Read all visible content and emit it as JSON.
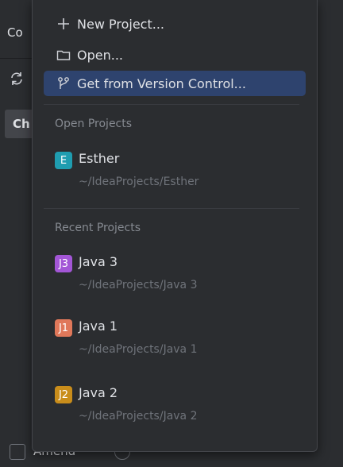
{
  "background": {
    "row1_text": "Co",
    "ch_text": "Ch",
    "amend_label": "Amend"
  },
  "menu": {
    "new_project": "New Project...",
    "open": "Open...",
    "get_from_vcs": "Get from Version Control..."
  },
  "open_projects": {
    "header": "Open Projects",
    "items": [
      {
        "badge": "E",
        "name": "Esther",
        "path": "~/IdeaProjects/Esther",
        "color": "#1f9db0"
      }
    ]
  },
  "recent_projects": {
    "header": "Recent Projects",
    "items": [
      {
        "badge": "J3",
        "name": "Java 3",
        "path": "~/IdeaProjects/Java 3",
        "color": "#a356d6"
      },
      {
        "badge": "J1",
        "name": "Java 1",
        "path": "~/IdeaProjects/Java 1",
        "color": "#e0785a"
      },
      {
        "badge": "J2",
        "name": "Java 2",
        "path": "~/IdeaProjects/Java 2",
        "color": "#c98d1b"
      }
    ]
  },
  "colors": {
    "selection": "#2e436e",
    "popup_bg": "#2b2d30",
    "secondary_text": "#6f737a"
  }
}
